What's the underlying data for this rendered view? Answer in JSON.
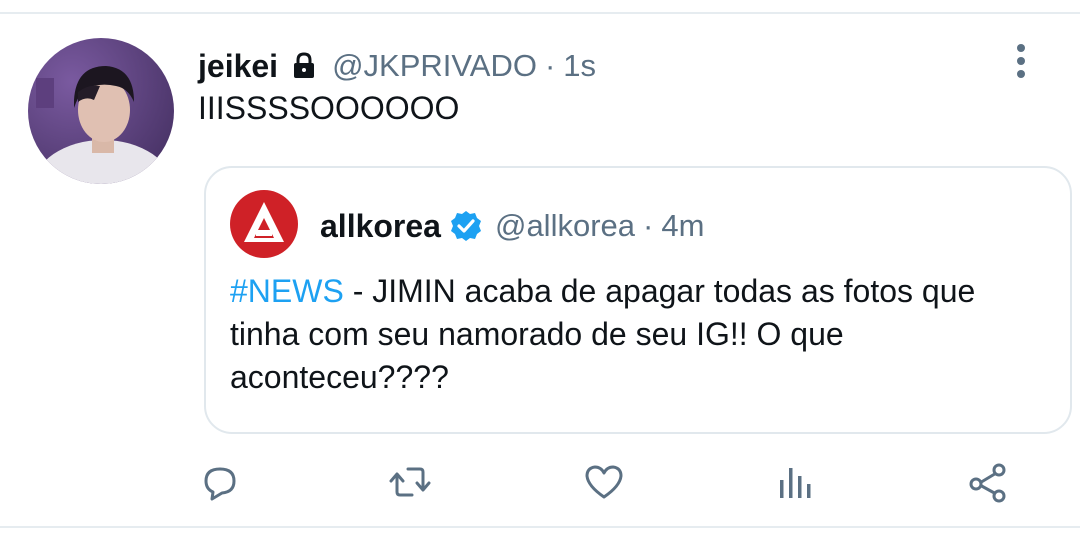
{
  "tweet": {
    "author_name": "jeikei",
    "handle": "@JKPRIVADO",
    "separator": "·",
    "time": "1s",
    "text": "IIISSSSOOOOOO"
  },
  "quoted_tweet": {
    "author_name": "allkorea",
    "handle": "@allkorea",
    "separator": "·",
    "time": "4m",
    "hashtag": "#NEWS",
    "text": " - JIMIN acaba de apagar todas as fotos que tinha com seu namorado de seu IG!! O que aconteceu????"
  },
  "actions": [
    {
      "icon": "reply-icon"
    },
    {
      "icon": "retweet-icon"
    },
    {
      "icon": "like-icon"
    },
    {
      "icon": "analytics-icon"
    },
    {
      "icon": "share-icon"
    }
  ],
  "colors": {
    "text_primary": "#0f1419",
    "text_secondary": "#5b7083",
    "accent": "#1da1f2",
    "icon_gray": "#5b7083",
    "border": "#e1e8ed",
    "brand_red": "#cf2127"
  }
}
